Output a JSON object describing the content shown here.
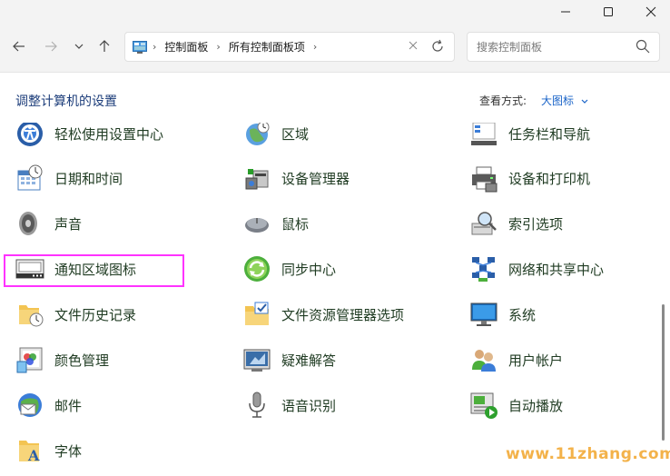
{
  "window": {
    "minimize_icon": "minimize-icon",
    "maximize_icon": "maximize-icon",
    "close_icon": "close-icon"
  },
  "address": {
    "crumbs": [
      "控制面板",
      "所有控制面板项"
    ],
    "search_placeholder": "搜索控制面板"
  },
  "header": {
    "title": "调整计算机的设置",
    "view_label": "查看方式:",
    "view_value": "大图标",
    "view_chevron": "chevron-down-icon"
  },
  "items": [
    {
      "label": "轻松使用设置中心",
      "icon": "ease-of-access-icon"
    },
    {
      "label": "区域",
      "icon": "region-icon"
    },
    {
      "label": "任务栏和导航",
      "icon": "taskbar-icon"
    },
    {
      "label": "日期和时间",
      "icon": "date-time-icon"
    },
    {
      "label": "设备管理器",
      "icon": "device-manager-icon"
    },
    {
      "label": "设备和打印机",
      "icon": "printer-icon"
    },
    {
      "label": "声音",
      "icon": "speaker-icon"
    },
    {
      "label": "鼠标",
      "icon": "mouse-icon"
    },
    {
      "label": "索引选项",
      "icon": "indexing-icon"
    },
    {
      "label": "通知区域图标",
      "icon": "notification-area-icon"
    },
    {
      "label": "同步中心",
      "icon": "sync-center-icon"
    },
    {
      "label": "网络和共享中心",
      "icon": "network-icon"
    },
    {
      "label": "文件历史记录",
      "icon": "file-history-icon"
    },
    {
      "label": "文件资源管理器选项",
      "icon": "folder-options-icon"
    },
    {
      "label": "系统",
      "icon": "system-monitor-icon"
    },
    {
      "label": "颜色管理",
      "icon": "color-management-icon"
    },
    {
      "label": "疑难解答",
      "icon": "troubleshooting-icon"
    },
    {
      "label": "用户帐户",
      "icon": "user-accounts-icon"
    },
    {
      "label": "邮件",
      "icon": "mail-icon"
    },
    {
      "label": "语音识别",
      "icon": "microphone-icon"
    },
    {
      "label": "自动播放",
      "icon": "autoplay-icon"
    },
    {
      "label": "字体",
      "icon": "fonts-icon"
    }
  ],
  "watermark": "www.11zhang.com"
}
